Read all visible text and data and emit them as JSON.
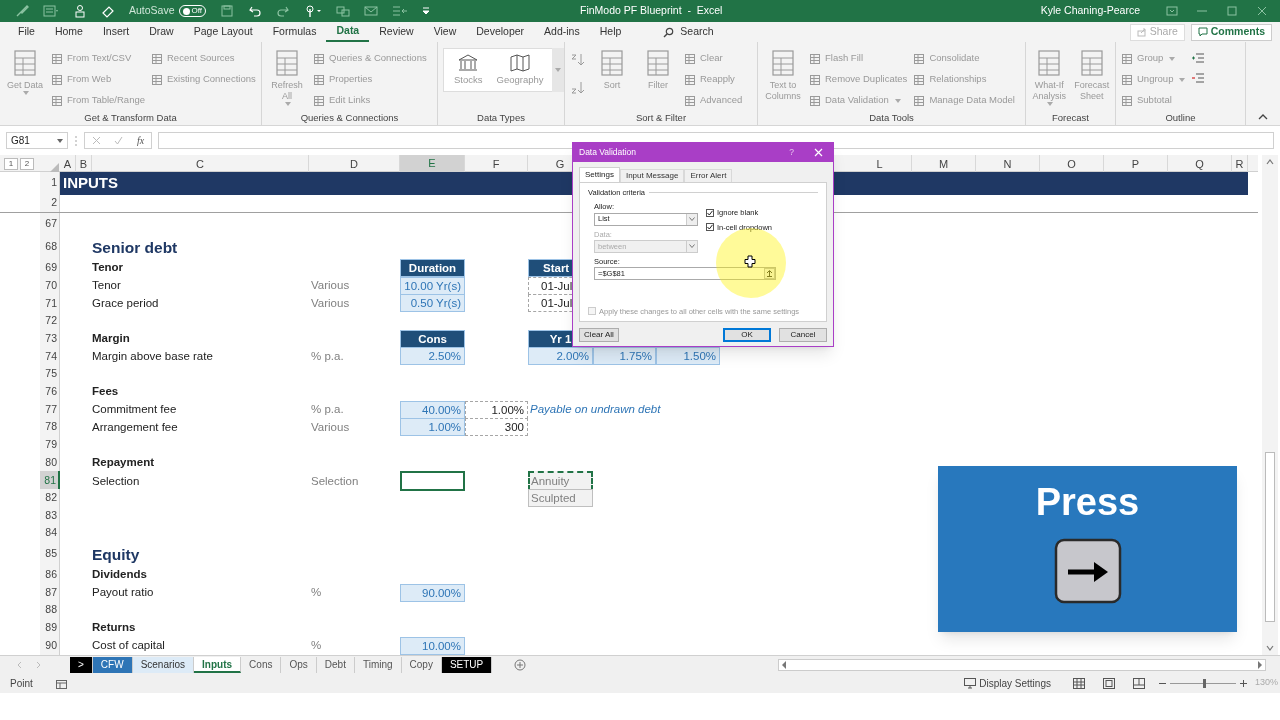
{
  "title_bar": {
    "autosave_label": "AutoSave",
    "autosave": {
      "label": "Off",
      "on": false
    },
    "title": "FinModo PF Blueprint  -  Excel",
    "user": "Kyle Chaning-Pearce"
  },
  "ribbon_tabs": [
    {
      "label": "File",
      "selected": false
    },
    {
      "label": "Home",
      "selected": false
    },
    {
      "label": "Insert",
      "selected": false
    },
    {
      "label": "Draw",
      "selected": false
    },
    {
      "label": "Page Layout",
      "selected": false
    },
    {
      "label": "Formulas",
      "selected": false
    },
    {
      "label": "Data",
      "selected": true
    },
    {
      "label": "Review",
      "selected": false
    },
    {
      "label": "View",
      "selected": false
    },
    {
      "label": "Developer",
      "selected": false
    },
    {
      "label": "Add-ins",
      "selected": false
    },
    {
      "label": "Help",
      "selected": false
    }
  ],
  "search": {
    "placeholder": "Search"
  },
  "share": "Share",
  "comments": "Comments",
  "ribbon_groups": [
    {
      "label": "Get & Transform Data",
      "items": [
        {
          "kind": "large",
          "label": "Get Data",
          "menu": true
        },
        {
          "kind": "small",
          "label": "From Text/CSV",
          "menu": false
        },
        {
          "kind": "small",
          "label": "From Web",
          "menu": false
        },
        {
          "kind": "small",
          "label": "From Table/Range",
          "menu": false
        },
        {
          "kind": "small",
          "label": "Recent Sources",
          "menu": false
        },
        {
          "kind": "small",
          "label": "Existing Connections",
          "menu": false
        }
      ]
    },
    {
      "label": "Queries & Connections",
      "items": [
        {
          "kind": "large",
          "label": "Refresh All",
          "menu": true
        },
        {
          "kind": "small",
          "label": "Queries & Connections",
          "menu": false
        },
        {
          "kind": "small",
          "label": "Properties",
          "menu": false
        },
        {
          "kind": "small",
          "label": "Edit Links",
          "menu": false
        }
      ]
    },
    {
      "label": "Data Types",
      "items": [
        {
          "kind": "gallery",
          "label": "Stocks"
        },
        {
          "kind": "gallery",
          "label": "Geography"
        }
      ]
    },
    {
      "label": "Sort & Filter",
      "items": [
        {
          "kind": "sorticons"
        },
        {
          "kind": "large",
          "label": "Sort",
          "menu": false
        },
        {
          "kind": "large",
          "label": "Filter",
          "menu": false
        },
        {
          "kind": "small",
          "label": "Clear",
          "menu": false
        },
        {
          "kind": "small",
          "label": "Reapply",
          "menu": false
        },
        {
          "kind": "small",
          "label": "Advanced",
          "menu": false
        }
      ]
    },
    {
      "label": "Data Tools",
      "items": [
        {
          "kind": "large",
          "label": "Text to Columns",
          "menu": false
        },
        {
          "kind": "small",
          "label": "Flash Fill",
          "menu": false
        },
        {
          "kind": "small",
          "label": "Remove Duplicates",
          "menu": false
        },
        {
          "kind": "small",
          "label": "Data Validation",
          "menu": true
        },
        {
          "kind": "small",
          "label": "Consolidate",
          "menu": false
        },
        {
          "kind": "small",
          "label": "Relationships",
          "menu": false
        },
        {
          "kind": "small",
          "label": "Manage Data Model",
          "menu": false
        }
      ]
    },
    {
      "label": "Forecast",
      "items": [
        {
          "kind": "large",
          "label": "What-If Analysis",
          "menu": true
        },
        {
          "kind": "large",
          "label": "Forecast Sheet",
          "menu": false
        }
      ]
    },
    {
      "label": "Outline",
      "items": [
        {
          "kind": "small",
          "label": "Group",
          "menu": true
        },
        {
          "kind": "small",
          "label": "Ungroup",
          "menu": true
        },
        {
          "kind": "small",
          "label": "Subtotal",
          "menu": false
        },
        {
          "kind": "detailicons"
        }
      ]
    }
  ],
  "formula_bar": {
    "name_box": "G81",
    "fx": "fx"
  },
  "outline_levels": [
    "1",
    "2"
  ],
  "columns": [
    {
      "letter": "A",
      "selected": false
    },
    {
      "letter": "B",
      "selected": false
    },
    {
      "letter": "C",
      "selected": false
    },
    {
      "letter": "D",
      "selected": false
    },
    {
      "letter": "E",
      "selected": true
    },
    {
      "letter": "F",
      "selected": false
    },
    {
      "letter": "G",
      "selected": false
    },
    {
      "letter": "L",
      "selected": false
    },
    {
      "letter": "M",
      "selected": false
    },
    {
      "letter": "N",
      "selected": false
    },
    {
      "letter": "O",
      "selected": false
    },
    {
      "letter": "P",
      "selected": false
    },
    {
      "letter": "Q",
      "selected": false
    },
    {
      "letter": "R",
      "selected": false
    }
  ],
  "rows": [
    {
      "number": "1",
      "kind": "title",
      "label": "INPUTS",
      "selected": false
    },
    {
      "number": "2",
      "kind": "blank",
      "selected": false
    },
    {
      "number": "67",
      "kind": "blank",
      "selected": false
    },
    {
      "number": "68",
      "kind": "section",
      "label": "Senior debt",
      "selected": false
    },
    {
      "number": "69",
      "kind": "group",
      "label": "Tenor",
      "selected": false,
      "cells": [
        {
          "kind": "header",
          "text": "Duration"
        },
        {
          "kind": "empty"
        },
        {
          "kind": "headercut",
          "text": "Start"
        }
      ]
    },
    {
      "number": "70",
      "kind": "item",
      "label": "Tenor",
      "unit": "Various",
      "selected": false,
      "cells": [
        {
          "kind": "input",
          "text": "10.00 Yr(s)"
        },
        {
          "kind": "empty"
        },
        {
          "kind": "datecut",
          "text": "01-Jul"
        }
      ]
    },
    {
      "number": "71",
      "kind": "item",
      "label": "Grace period",
      "unit": "Various",
      "selected": false,
      "cells": [
        {
          "kind": "input",
          "text": "0.50 Yr(s)"
        },
        {
          "kind": "empty"
        },
        {
          "kind": "datecut",
          "text": "01-Jul"
        }
      ]
    },
    {
      "number": "72",
      "kind": "blank",
      "selected": false
    },
    {
      "number": "73",
      "kind": "group",
      "label": "Margin",
      "selected": false,
      "cells": [
        {
          "kind": "header",
          "text": "Cons"
        },
        {
          "kind": "empty"
        },
        {
          "kind": "header",
          "text": "Yr 1"
        }
      ]
    },
    {
      "number": "74",
      "kind": "item",
      "label": "Margin above base rate",
      "unit": "% p.a.",
      "selected": false,
      "cells": [
        {
          "kind": "input",
          "text": "2.50%"
        },
        {
          "kind": "empty"
        },
        {
          "kind": "input",
          "text": "2.00%"
        },
        {
          "kind": "input",
          "text": "1.75%"
        },
        {
          "kind": "input",
          "text": "1.50%"
        }
      ]
    },
    {
      "number": "75",
      "kind": "blank",
      "selected": false
    },
    {
      "number": "76",
      "kind": "group",
      "label": "Fees",
      "selected": false
    },
    {
      "number": "77",
      "kind": "item",
      "label": "Commitment fee",
      "unit": "% p.a.",
      "selected": false,
      "cells": [
        {
          "kind": "input",
          "text": "40.00%"
        },
        {
          "kind": "calc",
          "text": "1.00%"
        },
        {
          "kind": "note",
          "text": "Payable on undrawn debt"
        }
      ]
    },
    {
      "number": "78",
      "kind": "item",
      "label": "Arrangement fee",
      "unit": "Various",
      "selected": false,
      "cells": [
        {
          "kind": "input",
          "text": "1.00%"
        },
        {
          "kind": "calc",
          "text": "300"
        }
      ]
    },
    {
      "number": "79",
      "kind": "blank",
      "selected": false
    },
    {
      "number": "80",
      "kind": "group",
      "label": "Repayment",
      "selected": false
    },
    {
      "number": "81",
      "kind": "item",
      "label": "Selection",
      "unit": "Selection",
      "selected": true,
      "cells": [
        {
          "kind": "active"
        },
        {
          "kind": "empty"
        },
        {
          "kind": "list",
          "text": "Annuity",
          "copied": true
        }
      ]
    },
    {
      "number": "82",
      "kind": "item",
      "selected": false,
      "cells": [
        {
          "kind": "empty"
        },
        {
          "kind": "empty"
        },
        {
          "kind": "list",
          "text": "Sculpted",
          "copied": false
        }
      ]
    },
    {
      "number": "83",
      "kind": "blank",
      "selected": false
    },
    {
      "number": "84",
      "kind": "blank",
      "selected": false
    },
    {
      "number": "85",
      "kind": "section",
      "label": "Equity",
      "selected": false
    },
    {
      "number": "86",
      "kind": "group",
      "label": "Dividends",
      "selected": false
    },
    {
      "number": "87",
      "kind": "item",
      "label": "Payout ratio",
      "unit": "%",
      "selected": false,
      "cells": [
        {
          "kind": "input",
          "text": "90.00%"
        }
      ]
    },
    {
      "number": "88",
      "kind": "blank",
      "selected": false
    },
    {
      "number": "89",
      "kind": "group",
      "label": "Returns",
      "selected": false
    },
    {
      "number": "90",
      "kind": "item",
      "label": "Cost of capital",
      "unit": "%",
      "selected": false,
      "cells": [
        {
          "kind": "input",
          "text": "10.00%"
        }
      ]
    }
  ],
  "dialog": {
    "title": "Data Validation",
    "help": "?",
    "tabs": [
      {
        "label": "Settings",
        "selected": true
      },
      {
        "label": "Input Message",
        "selected": false
      },
      {
        "label": "Error Alert",
        "selected": false
      }
    ],
    "section": "Validation criteria",
    "allow": {
      "label": "Allow:",
      "value": "List",
      "disabled": false
    },
    "data": {
      "label": "Data:",
      "value": "between",
      "disabled": true
    },
    "checkboxes": [
      {
        "label": "Ignore blank",
        "checked": true
      },
      {
        "label": "In-cell dropdown",
        "checked": true
      }
    ],
    "source": {
      "label": "Source:",
      "value": "=$G$81"
    },
    "apply": {
      "label": "Apply these changes to all other cells with the same settings",
      "checked": false,
      "disabled": true
    },
    "buttons": [
      {
        "label": "Clear All",
        "default": false
      },
      {
        "label": "OK",
        "default": true
      },
      {
        "label": "Cancel",
        "default": false
      }
    ]
  },
  "press_panel": {
    "label": "Press"
  },
  "sheet_tabs": [
    {
      "label": ">",
      "selected": false,
      "color": "#000000"
    },
    {
      "label": "CFW",
      "selected": false,
      "color": "#2e75b6"
    },
    {
      "label": "Scenarios",
      "selected": false,
      "color": "#ddebf7"
    },
    {
      "label": "Inputs",
      "selected": true
    },
    {
      "label": "Cons",
      "selected": false
    },
    {
      "label": "Ops",
      "selected": false
    },
    {
      "label": "Debt",
      "selected": false
    },
    {
      "label": "Timing",
      "selected": false
    },
    {
      "label": "Copy",
      "selected": false
    },
    {
      "label": "SETUP",
      "selected": false,
      "color": "#000000"
    }
  ],
  "status_bar": {
    "mode": "Point",
    "display_settings": "Display Settings",
    "zoom_slider": {
      "level": 0.52
    },
    "zoom": "130%"
  }
}
